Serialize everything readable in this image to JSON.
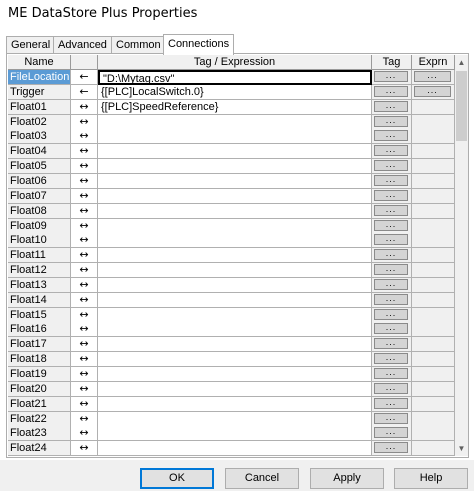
{
  "window": {
    "title": "ME DataStore Plus Properties"
  },
  "tabs": [
    {
      "label": "General",
      "active": false
    },
    {
      "label": "Advanced",
      "active": false
    },
    {
      "label": "Common",
      "active": false
    },
    {
      "label": "Connections",
      "active": true
    }
  ],
  "grid": {
    "headers": {
      "name": "Name",
      "direction": "",
      "expression": "Tag / Expression",
      "tag": "Tag",
      "exprn": "Exprn"
    },
    "button_label": "...",
    "rows": [
      {
        "name": "FileLocation",
        "dir": "←",
        "expr": "\"D:\\Mytag.csv\"",
        "exprn_button": true,
        "selected": true
      },
      {
        "name": "Trigger",
        "dir": "←",
        "expr": "{[PLC]LocalSwitch.0}",
        "exprn_button": true
      },
      {
        "name": "Float01",
        "dir": "↔",
        "expr": "{[PLC]SpeedReference}",
        "exprn_button": false
      },
      {
        "name": "Float02",
        "dir": "↔",
        "expr": "",
        "exprn_button": false
      },
      {
        "name": "Float03",
        "dir": "↔",
        "expr": "",
        "exprn_button": false
      },
      {
        "name": "Float04",
        "dir": "↔",
        "expr": "",
        "exprn_button": false
      },
      {
        "name": "Float05",
        "dir": "↔",
        "expr": "",
        "exprn_button": false
      },
      {
        "name": "Float06",
        "dir": "↔",
        "expr": "",
        "exprn_button": false
      },
      {
        "name": "Float07",
        "dir": "↔",
        "expr": "",
        "exprn_button": false
      },
      {
        "name": "Float08",
        "dir": "↔",
        "expr": "",
        "exprn_button": false
      },
      {
        "name": "Float09",
        "dir": "↔",
        "expr": "",
        "exprn_button": false
      },
      {
        "name": "Float10",
        "dir": "↔",
        "expr": "",
        "exprn_button": false
      },
      {
        "name": "Float11",
        "dir": "↔",
        "expr": "",
        "exprn_button": false
      },
      {
        "name": "Float12",
        "dir": "↔",
        "expr": "",
        "exprn_button": false
      },
      {
        "name": "Float13",
        "dir": "↔",
        "expr": "",
        "exprn_button": false
      },
      {
        "name": "Float14",
        "dir": "↔",
        "expr": "",
        "exprn_button": false
      },
      {
        "name": "Float15",
        "dir": "↔",
        "expr": "",
        "exprn_button": false
      },
      {
        "name": "Float16",
        "dir": "↔",
        "expr": "",
        "exprn_button": false
      },
      {
        "name": "Float17",
        "dir": "↔",
        "expr": "",
        "exprn_button": false
      },
      {
        "name": "Float18",
        "dir": "↔",
        "expr": "",
        "exprn_button": false
      },
      {
        "name": "Float19",
        "dir": "↔",
        "expr": "",
        "exprn_button": false
      },
      {
        "name": "Float20",
        "dir": "↔",
        "expr": "",
        "exprn_button": false
      },
      {
        "name": "Float21",
        "dir": "↔",
        "expr": "",
        "exprn_button": false
      },
      {
        "name": "Float22",
        "dir": "↔",
        "expr": "",
        "exprn_button": false
      },
      {
        "name": "Float23",
        "dir": "↔",
        "expr": "",
        "exprn_button": false
      },
      {
        "name": "Float24",
        "dir": "↔",
        "expr": "",
        "exprn_button": false
      }
    ]
  },
  "scrollbar": {
    "up_icon": "arrow-up-icon",
    "down_icon": "arrow-down-icon"
  },
  "buttons": {
    "ok": "OK",
    "cancel": "Cancel",
    "apply": "Apply",
    "help": "Help"
  }
}
